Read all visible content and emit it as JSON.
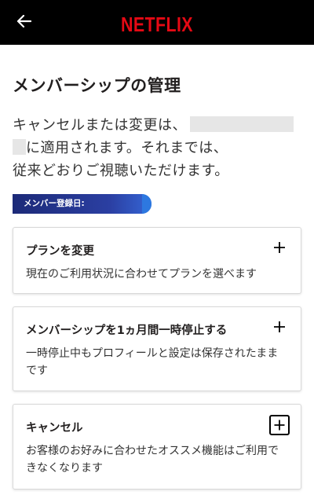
{
  "header": {
    "brand": "NETFLIX",
    "brand_color": "#E50914",
    "back_icon": "arrow-left-icon"
  },
  "page": {
    "title": "メンバーシップの管理",
    "notice_line1": "キャンセルまたは変更は、",
    "notice_line2": "に適用されます。それまでは、",
    "notice_line3": "従来どおりご視聴いただけます。",
    "member_since_label": "メンバー登録日:"
  },
  "cards": [
    {
      "title": "プランを変更",
      "description": "現在のご利用状況に合わせてプランを選べます",
      "icon": "plus-icon"
    },
    {
      "title": "メンバーシップを1ヵ月間一時停止する",
      "description": "一時停止中もプロフィールと設定は保存されたままです",
      "icon": "plus-icon"
    },
    {
      "title": "キャンセル",
      "description": "お客様のお好みに合わせたオススメ機能はご利用できなくなります",
      "icon": "plus-icon"
    }
  ],
  "colors": {
    "topbar": "#000000",
    "badge_gradient_start": "#1C2A78",
    "badge_gradient_end": "#3566D6"
  }
}
